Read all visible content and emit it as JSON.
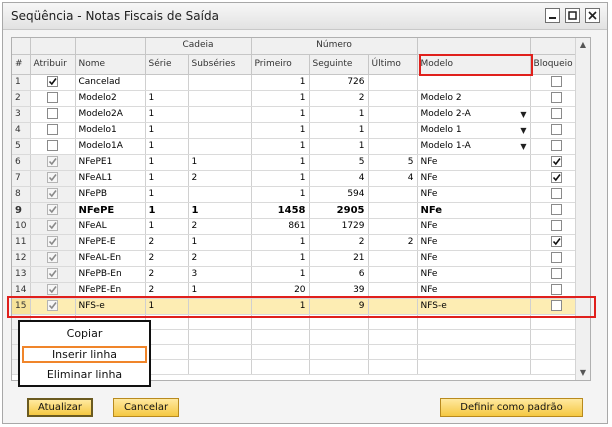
{
  "window": {
    "title": "Seqüência - Notas Fiscais de Saída"
  },
  "header": {
    "group_cadeia": "Cadeia",
    "group_numero": "Número",
    "columns": [
      "#",
      "Atribuir",
      "Nome",
      "Série",
      "Subséries",
      "Primeiro",
      "Seguinte",
      "Último",
      "Modelo",
      "Bloqueio"
    ]
  },
  "rows": [
    {
      "num": "1",
      "atribuir": true,
      "atribuir_enabled": true,
      "nome": "Cancelad",
      "serie": "",
      "subseries": "",
      "primeiro": "1",
      "seguinte": "726",
      "ultimo": "",
      "modelo": "",
      "dropdown": false,
      "bloqueio": false
    },
    {
      "num": "2",
      "atribuir": false,
      "atribuir_enabled": true,
      "nome": "Modelo2",
      "serie": "1",
      "subseries": "",
      "primeiro": "1",
      "seguinte": "2",
      "ultimo": "",
      "modelo": "Modelo 2",
      "dropdown": false,
      "bloqueio": false
    },
    {
      "num": "3",
      "atribuir": false,
      "atribuir_enabled": true,
      "nome": "Modelo2A",
      "serie": "1",
      "subseries": "",
      "primeiro": "1",
      "seguinte": "1",
      "ultimo": "",
      "modelo": "Modelo 2-A",
      "dropdown": true,
      "bloqueio": false
    },
    {
      "num": "4",
      "atribuir": false,
      "atribuir_enabled": true,
      "nome": "Modelo1",
      "serie": "1",
      "subseries": "",
      "primeiro": "1",
      "seguinte": "1",
      "ultimo": "",
      "modelo": "Modelo 1",
      "dropdown": true,
      "bloqueio": false
    },
    {
      "num": "5",
      "atribuir": false,
      "atribuir_enabled": true,
      "nome": "Modelo1A",
      "serie": "1",
      "subseries": "",
      "primeiro": "1",
      "seguinte": "1",
      "ultimo": "",
      "modelo": "Modelo 1-A",
      "dropdown": true,
      "bloqueio": false
    },
    {
      "num": "6",
      "atribuir": true,
      "atribuir_enabled": false,
      "nome": "NFePE1",
      "serie": "1",
      "subseries": "1",
      "primeiro": "1",
      "seguinte": "5",
      "ultimo": "5",
      "modelo": "NFe",
      "dropdown": false,
      "bloqueio": true
    },
    {
      "num": "7",
      "atribuir": true,
      "atribuir_enabled": false,
      "nome": "NFeAL1",
      "serie": "1",
      "subseries": "2",
      "primeiro": "1",
      "seguinte": "4",
      "ultimo": "4",
      "modelo": "NFe",
      "dropdown": false,
      "bloqueio": true
    },
    {
      "num": "8",
      "atribuir": true,
      "atribuir_enabled": false,
      "nome": "NFePB",
      "serie": "1",
      "subseries": "",
      "primeiro": "1",
      "seguinte": "594",
      "ultimo": "",
      "modelo": "NFe",
      "dropdown": false,
      "bloqueio": false
    },
    {
      "num": "9",
      "atribuir": true,
      "atribuir_enabled": false,
      "nome": "NFePE",
      "serie": "1",
      "subseries": "1",
      "primeiro": "1458",
      "seguinte": "2905",
      "ultimo": "",
      "modelo": "NFe",
      "dropdown": false,
      "bloqueio": false,
      "bold": true
    },
    {
      "num": "10",
      "atribuir": true,
      "atribuir_enabled": false,
      "nome": "NFeAL",
      "serie": "1",
      "subseries": "2",
      "primeiro": "861",
      "seguinte": "1729",
      "ultimo": "",
      "modelo": "NFe",
      "dropdown": false,
      "bloqueio": false
    },
    {
      "num": "11",
      "atribuir": true,
      "atribuir_enabled": false,
      "nome": "NFePE-E",
      "serie": "2",
      "subseries": "1",
      "primeiro": "1",
      "seguinte": "2",
      "ultimo": "2",
      "modelo": "NFe",
      "dropdown": false,
      "bloqueio": true
    },
    {
      "num": "12",
      "atribuir": true,
      "atribuir_enabled": false,
      "nome": "NFeAL-En",
      "serie": "2",
      "subseries": "2",
      "primeiro": "1",
      "seguinte": "21",
      "ultimo": "",
      "modelo": "NFe",
      "dropdown": false,
      "bloqueio": false
    },
    {
      "num": "13",
      "atribuir": true,
      "atribuir_enabled": false,
      "nome": "NFePB-En",
      "serie": "2",
      "subseries": "3",
      "primeiro": "1",
      "seguinte": "6",
      "ultimo": "",
      "modelo": "NFe",
      "dropdown": false,
      "bloqueio": false
    },
    {
      "num": "14",
      "atribuir": true,
      "atribuir_enabled": false,
      "nome": "NFePE-En",
      "serie": "2",
      "subseries": "1",
      "primeiro": "20",
      "seguinte": "39",
      "ultimo": "",
      "modelo": "NFe",
      "dropdown": false,
      "bloqueio": false
    },
    {
      "num": "15",
      "atribuir": true,
      "atribuir_enabled": false,
      "nome": "NFS-e",
      "serie": "1",
      "subseries": "",
      "primeiro": "1",
      "seguinte": "9",
      "ultimo": "",
      "modelo": "NFS-e",
      "dropdown": false,
      "bloqueio": false,
      "selected": true
    }
  ],
  "context_menu": {
    "items": [
      "Copiar",
      "Inserir linha",
      "Eliminar linha"
    ],
    "hover_index": 1
  },
  "buttons": {
    "update": "Atualizar",
    "cancel": "Cancelar",
    "set_default": "Definir como padrão"
  },
  "colors": {
    "highlight_border": "#e0201c",
    "menu_hover": "#f0852a",
    "button_fill": "#f5c842",
    "selected_row": "#fdedb3"
  }
}
